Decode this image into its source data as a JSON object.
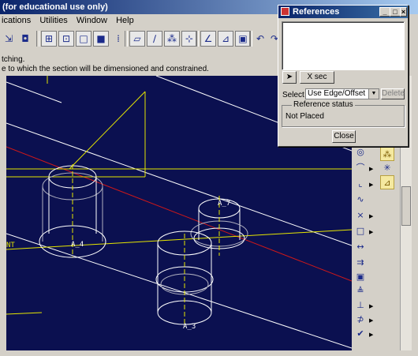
{
  "window": {
    "title": "(for educational use only)"
  },
  "menu": [
    "ications",
    "Utilities",
    "Window",
    "Help"
  ],
  "messages": [
    "tching.",
    "e to which the section will be dimensioned and constrained."
  ],
  "toolbar_icons": [
    "filter-icon",
    "display-icon",
    "wireframe-icon",
    "hidden-line-icon",
    "no-hidden-icon",
    "shaded-icon",
    "datum-plane-icon",
    "datum-axis-icon",
    "datum-point-icon",
    "coordinate-system-icon",
    "sketch-icon",
    "sketch-constraint-icon",
    "modify-icon",
    "undo-icon",
    "redo-icon"
  ],
  "canvas": {
    "labels": {
      "a4": "A_4",
      "a7": "A_7",
      "a3": "A_3",
      "left_edge": "NT"
    },
    "colors": {
      "background": "#0b1050",
      "datum": "#e6e600",
      "edge": "#ffffff",
      "red_line": "#d01818"
    }
  },
  "right_toolbar": {
    "icons": [
      "circle-icon",
      "arc-icon",
      "fillet-icon",
      "spline-icon",
      "point-icon",
      "rectangle-icon",
      "dimension-icon",
      "modify-dimension-icon",
      "constraint-icon",
      "text-icon",
      "trim-icon",
      "mirror-icon",
      "done-icon"
    ],
    "side_icons": [
      "intent-point-icon",
      "cross-icon",
      "ruler-icon"
    ]
  },
  "references_dialog": {
    "title": "References",
    "title_buttons": [
      "_",
      "□",
      "×"
    ],
    "xsec_label": "X sec",
    "select_label": "Select",
    "select_value": "Use Edge/Offset",
    "delete_label": "Delete",
    "status_group": "Reference status",
    "status_value": "Not Placed",
    "close_label": "Close"
  }
}
